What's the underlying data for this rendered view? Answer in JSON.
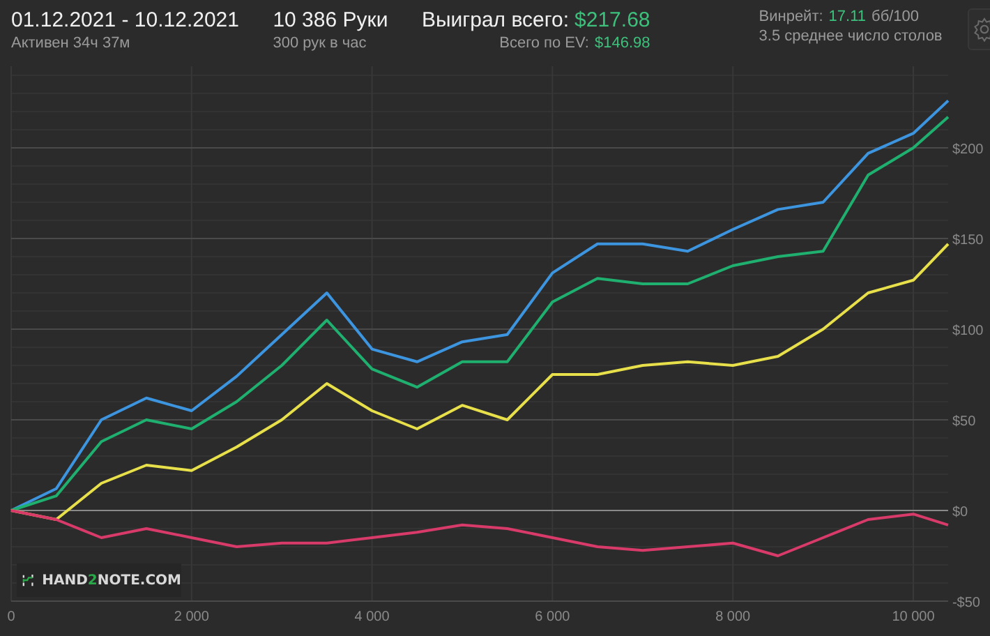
{
  "header": {
    "date_range": "01.12.2021 - 10.12.2021",
    "active_time": "Активен 34ч 37м",
    "hands": "10 386 Руки",
    "hands_per_hour": "300 рук в час",
    "won_label": "Выиграл всего:",
    "won_value": "$217.68",
    "ev_label": "Всего по EV:",
    "ev_value": "$146.98",
    "winrate_label": "Винрейт:",
    "winrate_value": "17.11",
    "winrate_unit": "бб/100",
    "tables": "3.5 среднее число столов"
  },
  "logo": {
    "parts": [
      {
        "text": "HAND",
        "accent": false
      },
      {
        "text": "2",
        "accent": true
      },
      {
        "text": "NOTE.COM",
        "accent": false
      }
    ]
  },
  "chart_data": {
    "type": "line",
    "x": [
      0,
      500,
      1000,
      1500,
      2000,
      2500,
      3000,
      3500,
      4000,
      4500,
      5000,
      5500,
      6000,
      6500,
      7000,
      7500,
      8000,
      8500,
      9000,
      9500,
      10000,
      10386
    ],
    "grid": true,
    "xlim": [
      0,
      10386
    ],
    "ylim": [
      -50,
      245
    ],
    "xticks": [
      {
        "value": 0,
        "label": "0"
      },
      {
        "value": 2000,
        "label": "2 000"
      },
      {
        "value": 4000,
        "label": "4 000"
      },
      {
        "value": 6000,
        "label": "6 000"
      },
      {
        "value": 8000,
        "label": "8 000"
      },
      {
        "value": 10000,
        "label": "10 000"
      }
    ],
    "yticks": [
      {
        "value": -50,
        "label": "-$50"
      },
      {
        "value": 0,
        "label": "$0"
      },
      {
        "value": 50,
        "label": "$50"
      },
      {
        "value": 100,
        "label": "$100"
      },
      {
        "value": 150,
        "label": "$150"
      },
      {
        "value": 200,
        "label": "$200"
      }
    ],
    "series": [
      {
        "color": "#3d95e0",
        "values": [
          0,
          12,
          50,
          62,
          55,
          74,
          97,
          120,
          89,
          82,
          93,
          97,
          131,
          147,
          147,
          143,
          155,
          166,
          170,
          197,
          208,
          226
        ]
      },
      {
        "color": "#1fb070",
        "values": [
          0,
          8,
          38,
          50,
          45,
          60,
          80,
          105,
          78,
          68,
          82,
          82,
          115,
          128,
          125,
          125,
          135,
          140,
          143,
          185,
          200,
          217
        ]
      },
      {
        "color": "#e8e04a",
        "values": [
          0,
          -5,
          15,
          25,
          22,
          35,
          50,
          70,
          55,
          45,
          58,
          50,
          75,
          75,
          80,
          82,
          80,
          85,
          100,
          120,
          127,
          147
        ]
      },
      {
        "color": "#d83a6a",
        "values": [
          0,
          -5,
          -15,
          -10,
          -15,
          -20,
          -18,
          -18,
          -15,
          -12,
          -8,
          -10,
          -15,
          -20,
          -22,
          -20,
          -18,
          -25,
          -15,
          -5,
          -2,
          -8
        ]
      }
    ]
  }
}
